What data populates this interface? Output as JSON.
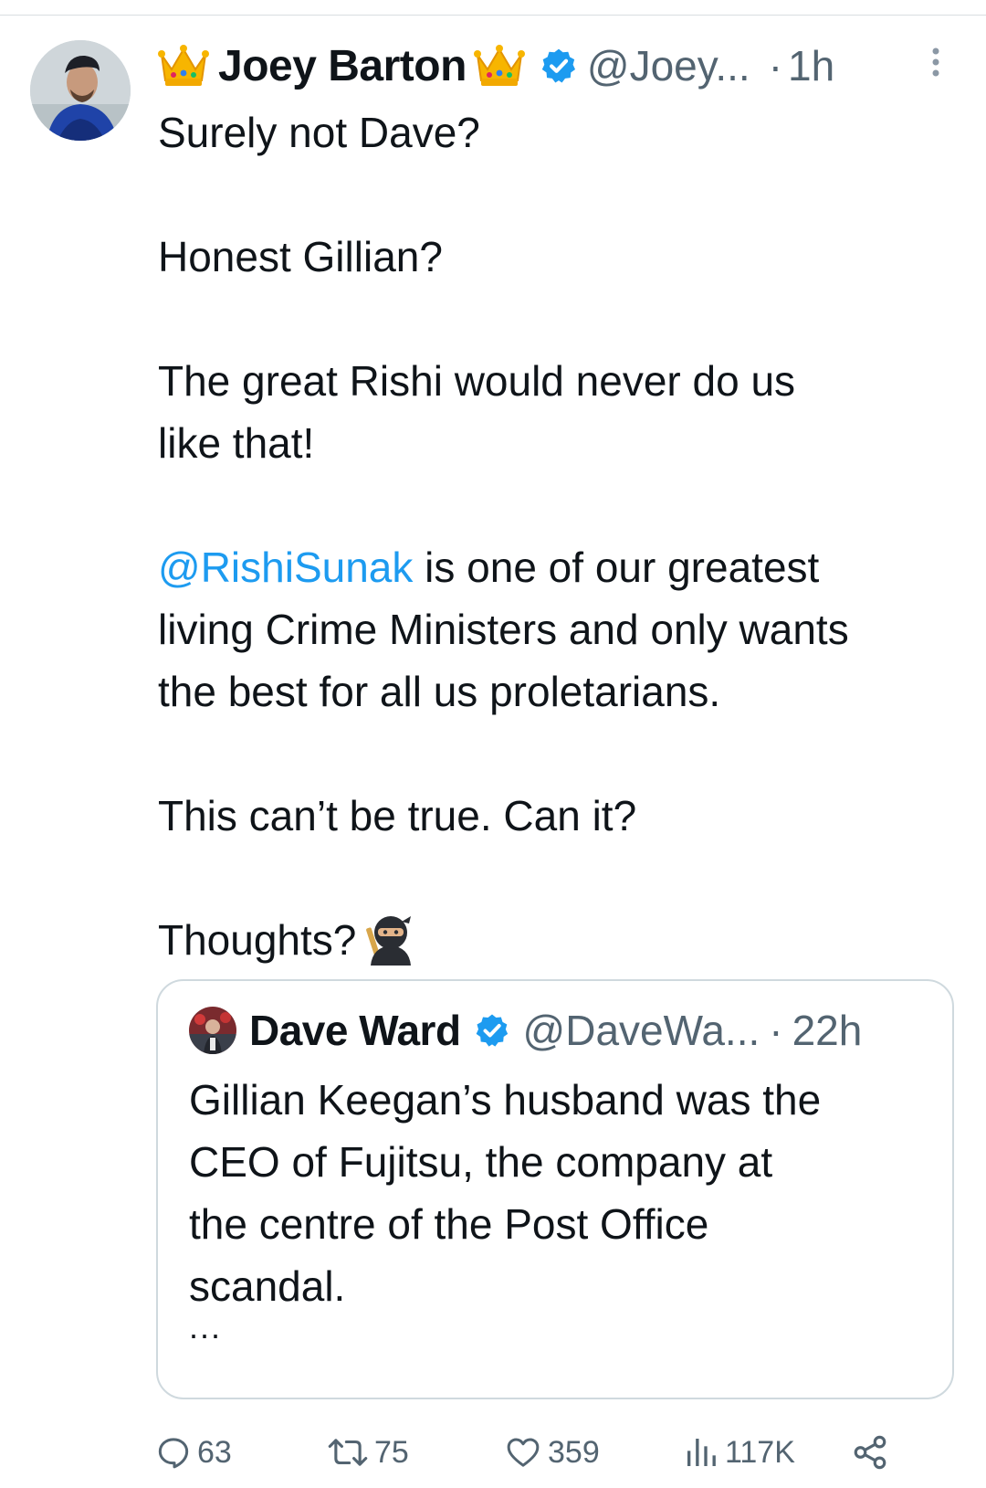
{
  "tweet": {
    "display_name": "Joey Barton",
    "name_emoji": "crown",
    "handle": "@Joey...",
    "separator": "·",
    "time": "1h",
    "verified": true,
    "text_lines": {
      "l1": "Surely not Dave?",
      "l2": "Honest Gillian?",
      "l3a": "The great Rishi would never do us",
      "l3b": "like that!",
      "mention": "@RishiSunak",
      "l4a": " is one of our greatest",
      "l4b": "living Crime Ministers and only wants",
      "l4c": "the best for all us proletarians.",
      "l5": "This can’t be true. Can it?",
      "l6": "Thoughts?"
    },
    "trailing_emoji": "ninja"
  },
  "quote": {
    "display_name": "Dave Ward",
    "handle": "@DaveWa...",
    "separator": "·",
    "time": "22h",
    "verified": true,
    "text_lines": [
      "Gillian Keegan’s husband was the",
      "CEO of Fujitsu, the company at",
      "the centre of the Post Office",
      "scandal."
    ],
    "more": "..."
  },
  "actions": {
    "replies": "63",
    "reposts": "75",
    "likes": "359",
    "views": "117K",
    "share_icon": "share-icon"
  },
  "colors": {
    "text": "#0f1419",
    "secondary": "#536471",
    "link": "#1d9bf0",
    "verified_badge": "#1d9bf0",
    "border": "#cfd9de"
  }
}
